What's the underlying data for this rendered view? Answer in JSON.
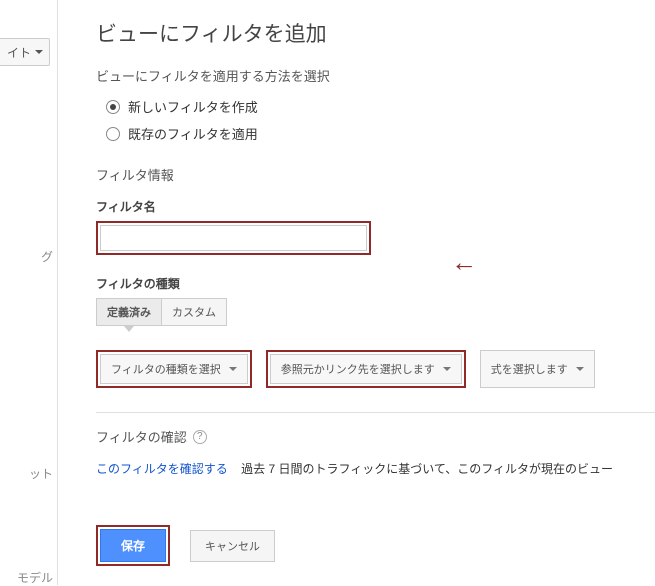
{
  "sidebar": {
    "dropdown_label": "イト",
    "item_g": "グ",
    "item_t": "ット",
    "item_model": "モデル"
  },
  "page": {
    "title": "ビューにフィルタを追加",
    "method_title": "ビューにフィルタを適用する方法を選択",
    "radio_create": "新しいフィルタを作成",
    "radio_existing": "既存のフィルタを適用",
    "info_title": "フィルタ情報",
    "name_label": "フィルタ名",
    "name_value": "",
    "type_label": "フィルタの種類",
    "tab_defined": "定義済み",
    "tab_custom": "カスタム",
    "dropdown_type": "フィルタの種類を選択",
    "dropdown_source": "参照元かリンク先を選択します",
    "dropdown_expr": "式を選択します",
    "verify_title": "フィルタの確認",
    "verify_link": "このフィルタを確認する",
    "verify_text": "過去 7 日間のトラフィックに基づいて、このフィルタが現在のビュー",
    "save": "保存",
    "cancel": "キャンセル"
  }
}
